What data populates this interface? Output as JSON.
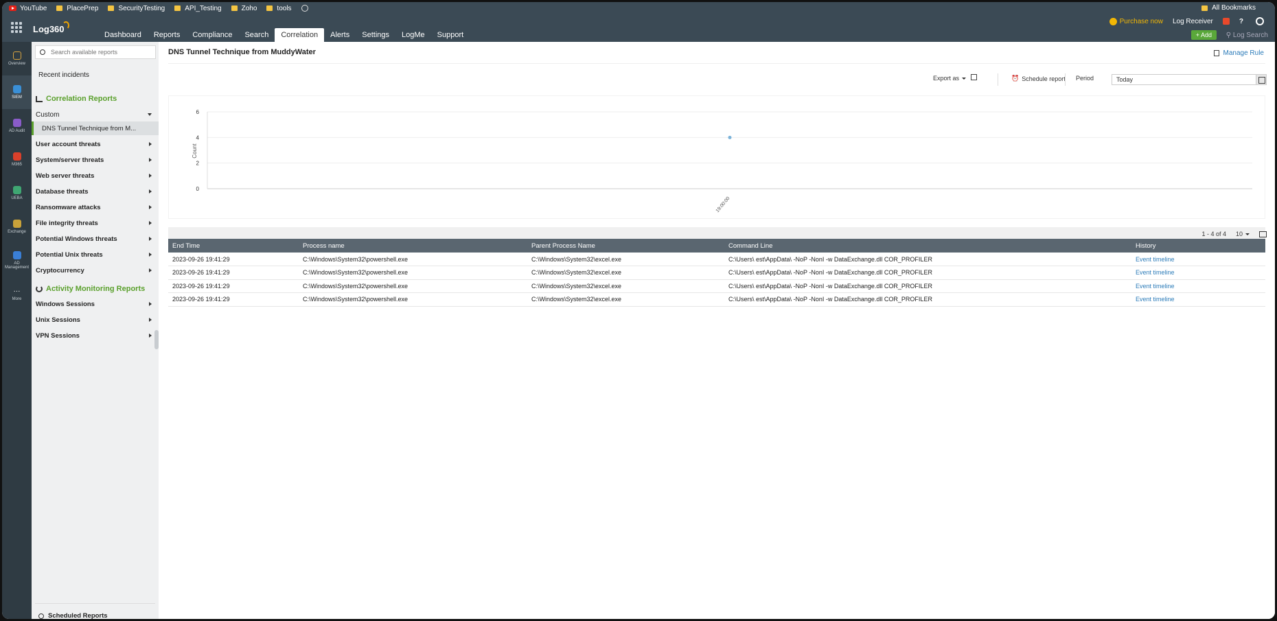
{
  "bookmarks": {
    "items": [
      {
        "label": "YouTube",
        "icon": "youtube-icon"
      },
      {
        "label": "PlacePrep",
        "icon": "folder-icon"
      },
      {
        "label": "SecurityTesting",
        "icon": "folder-icon"
      },
      {
        "label": "API_Testing",
        "icon": "folder-icon"
      },
      {
        "label": "Zoho",
        "icon": "folder-icon"
      },
      {
        "label": "tools",
        "icon": "folder-icon"
      }
    ],
    "all_bookmarks": "All Bookmarks"
  },
  "header": {
    "logo": "Log360",
    "tabs": [
      "Dashboard",
      "Reports",
      "Compliance",
      "Search",
      "Correlation",
      "Alerts",
      "Settings",
      "LogMe",
      "Support"
    ],
    "active_tab": "Correlation",
    "purchase": "Purchase now",
    "log_receiver": "Log Receiver",
    "help": "?",
    "add_button": "+ Add",
    "log_search": "Log Search"
  },
  "rail": {
    "items": [
      {
        "label": "Overview",
        "color": "#d9a441"
      },
      {
        "label": "SIEM",
        "color": "#3a8fd6"
      },
      {
        "label": "AD Audit",
        "color": "#8a5cc9"
      },
      {
        "label": "M365",
        "color": "#d9402b"
      },
      {
        "label": "UEBA",
        "color": "#3fa672"
      },
      {
        "label": "Exchange",
        "color": "#c9a23a"
      },
      {
        "label": "AD Management",
        "color": "#3a7fd6"
      },
      {
        "label": "More",
        "color": "#2f3b43"
      }
    ]
  },
  "sidebar": {
    "search_placeholder": "Search available reports",
    "recent_incidents": "Recent incidents",
    "correlation_reports": "Correlation Reports",
    "custom": "Custom",
    "selected_report": "DNS Tunnel Technique from M...",
    "categories": [
      "User account threats",
      "System/server threats",
      "Web server threats",
      "Database threats",
      "Ransomware attacks",
      "File integrity threats",
      "Potential Windows threats",
      "Potential Unix threats",
      "Cryptocurrency"
    ],
    "activity_monitoring": "Activity Monitoring Reports",
    "activity_items": [
      "Windows Sessions",
      "Unix Sessions",
      "VPN Sessions"
    ],
    "scheduled_reports": "Scheduled Reports"
  },
  "main": {
    "title": "DNS Tunnel Technique from MuddyWater",
    "manage_rule": "Manage Rule",
    "export_as": "Export as",
    "schedule_report": "Schedule report",
    "period_label": "Period",
    "period_value": "Today",
    "pager": {
      "range": "1 - 4 of 4",
      "per_page": "10"
    }
  },
  "chart_data": {
    "type": "scatter",
    "ylabel": "Count",
    "xlabel": "",
    "yticks": [
      0,
      2,
      4,
      6
    ],
    "ylim": [
      0,
      6
    ],
    "x": [
      "19:00:00"
    ],
    "values": [
      4
    ],
    "color": "#7bb3d9"
  },
  "table": {
    "columns": [
      "End Time",
      "Process name",
      "Parent Process Name",
      "Command Line",
      "History"
    ],
    "rows": [
      [
        "2023-09-26 19:41:29",
        "C:\\Windows\\System32\\powershell.exe",
        "C:\\Windows\\System32\\excel.exe",
        "C:\\Users\\ est\\AppData\\ -NoP -NonI -w DataExchange.dll COR_PROFILER",
        "Event timeline"
      ],
      [
        "2023-09-26 19:41:29",
        "C:\\Windows\\System32\\powershell.exe",
        "C:\\Windows\\System32\\excel.exe",
        "C:\\Users\\ est\\AppData\\ -NoP -NonI -w DataExchange.dll COR_PROFILER",
        "Event timeline"
      ],
      [
        "2023-09-26 19:41:29",
        "C:\\Windows\\System32\\powershell.exe",
        "C:\\Windows\\System32\\excel.exe",
        "C:\\Users\\ est\\AppData\\ -NoP -NonI -w DataExchange.dll COR_PROFILER",
        "Event timeline"
      ],
      [
        "2023-09-26 19:41:29",
        "C:\\Windows\\System32\\powershell.exe",
        "C:\\Windows\\System32\\excel.exe",
        "C:\\Users\\ est\\AppData\\ -NoP -NonI -w DataExchange.dll COR_PROFILER",
        "Event timeline"
      ]
    ]
  }
}
